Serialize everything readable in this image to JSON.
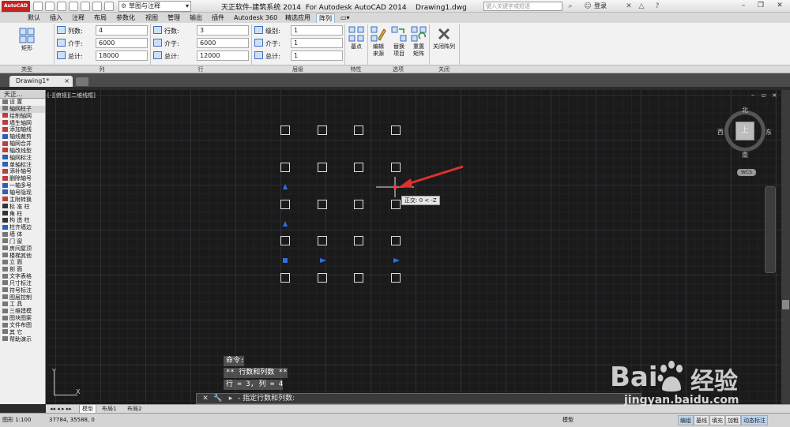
{
  "titlebar": {
    "app_logo": "AutoCAD",
    "workspace": "草图与注释",
    "title": "天正软件-建筑系统 2014  For Autodesk AutoCAD 2014    Drawing1.dwg",
    "search_placeholder": "键入关键字或短语",
    "signin": "登录"
  },
  "menu_tabs": [
    "默认",
    "插入",
    "注释",
    "布局",
    "参数化",
    "视图",
    "管理",
    "输出",
    "插件",
    "Autodesk 360",
    "精选应用",
    "阵列"
  ],
  "active_menu_tab": "阵列",
  "ribbon": {
    "type_button": "矩形",
    "columns": {
      "label1": "列数:",
      "value1": "4",
      "label2": "介于:",
      "value2": "6000",
      "label3": "总计:",
      "value3": "18000"
    },
    "rows": {
      "label1": "行数:",
      "value1": "3",
      "label2": "介于:",
      "value2": "6000",
      "label3": "总计:",
      "value3": "12000"
    },
    "levels": {
      "label1": "级别:",
      "value1": "1",
      "label2": "介于:",
      "value2": "1",
      "label3": "总计:",
      "value3": "1"
    },
    "base_point": "基点",
    "edit_source": "编辑来源",
    "replace_item": "替换项目",
    "reset_array": "重置矩阵",
    "close_array": "关闭阵列",
    "panels": [
      "类型",
      "列",
      "行",
      "层级",
      "特性",
      "选项",
      "关闭"
    ]
  },
  "doc_tab": "Drawing1*",
  "palette": {
    "title": "天正...",
    "items": [
      {
        "label": "设    置",
        "group": false,
        "color": "#777777"
      },
      {
        "label": "轴网柱子",
        "group": true,
        "color": "#777777"
      },
      {
        "label": "绘制轴网",
        "group": false,
        "color": "#c23b3b"
      },
      {
        "label": "墙生轴网",
        "group": false,
        "color": "#c23b3b"
      },
      {
        "label": "添加轴线",
        "group": false,
        "color": "#c23b3b"
      },
      {
        "label": "轴线裁剪",
        "group": false,
        "color": "#2b5fb8"
      },
      {
        "label": "轴网合并",
        "group": false,
        "color": "#c23b3b"
      },
      {
        "label": "轴改线型",
        "group": false,
        "color": "#c23b3b"
      },
      {
        "label": "轴网标注",
        "group": false,
        "color": "#2b5fb8"
      },
      {
        "label": "单轴标注",
        "group": false,
        "color": "#2b5fb8"
      },
      {
        "label": "添补轴号",
        "group": false,
        "color": "#c23b3b"
      },
      {
        "label": "删除轴号",
        "group": false,
        "color": "#c23b3b"
      },
      {
        "label": "一轴多号",
        "group": false,
        "color": "#2b5fb8"
      },
      {
        "label": "轴号隐现",
        "group": false,
        "color": "#2b5fb8"
      },
      {
        "label": "主附转换",
        "group": false,
        "color": "#c23b3b"
      },
      {
        "label": "标 准 柱",
        "group": false,
        "color": "#333333"
      },
      {
        "label": "角    柱",
        "group": false,
        "color": "#333333"
      },
      {
        "label": "构 造 柱",
        "group": false,
        "color": "#333333"
      },
      {
        "label": "柱齐墙边",
        "group": false,
        "color": "#2b5fb8"
      },
      {
        "label": "墙    体",
        "group": false,
        "color": "#777777"
      },
      {
        "label": "门    窗",
        "group": false,
        "color": "#777777"
      },
      {
        "label": "房间屋顶",
        "group": false,
        "color": "#777777"
      },
      {
        "label": "楼梯其他",
        "group": false,
        "color": "#777777"
      },
      {
        "label": "立    面",
        "group": false,
        "color": "#777777"
      },
      {
        "label": "剖    面",
        "group": false,
        "color": "#777777"
      },
      {
        "label": "文字表格",
        "group": false,
        "color": "#777777"
      },
      {
        "label": "尺寸标注",
        "group": false,
        "color": "#777777"
      },
      {
        "label": "符号标注",
        "group": false,
        "color": "#777777"
      },
      {
        "label": "图层控制",
        "group": false,
        "color": "#777777"
      },
      {
        "label": "工    具",
        "group": false,
        "color": "#777777"
      },
      {
        "label": "三维建模",
        "group": false,
        "color": "#777777"
      },
      {
        "label": "图块图案",
        "group": false,
        "color": "#777777"
      },
      {
        "label": "文件布图",
        "group": false,
        "color": "#777777"
      },
      {
        "label": "其    它",
        "group": false,
        "color": "#777777"
      },
      {
        "label": "帮助演示",
        "group": false,
        "color": "#777777"
      }
    ]
  },
  "canvas": {
    "viewport_label": "[-][俯视][二维线框]",
    "array_rows": 5,
    "array_cols": 4,
    "ortho_tooltip": "正交: 0 < -Z",
    "viewcube": {
      "north": "北",
      "south": "南",
      "east": "东",
      "west": "西",
      "top": "上",
      "wcs": "WCS"
    },
    "ucs_x": "X",
    "ucs_y": "Y"
  },
  "command": {
    "history": [
      "命令:",
      "** 行数和列数 **",
      "行 = 3, 列 = 4"
    ],
    "prompt": "- 指定行数和列数:"
  },
  "layout_tabs": [
    "模型",
    "布局1",
    "布局2"
  ],
  "status": {
    "scale": "图形 1:100",
    "coords": "37784, 35588, 0",
    "model": "模型",
    "buttons": [
      "编组",
      "基线",
      "填充",
      "加粗",
      "动态标注"
    ]
  },
  "watermark": {
    "bai": "Bai",
    "du": "经验",
    "url": "jingyan.baidu.com"
  }
}
